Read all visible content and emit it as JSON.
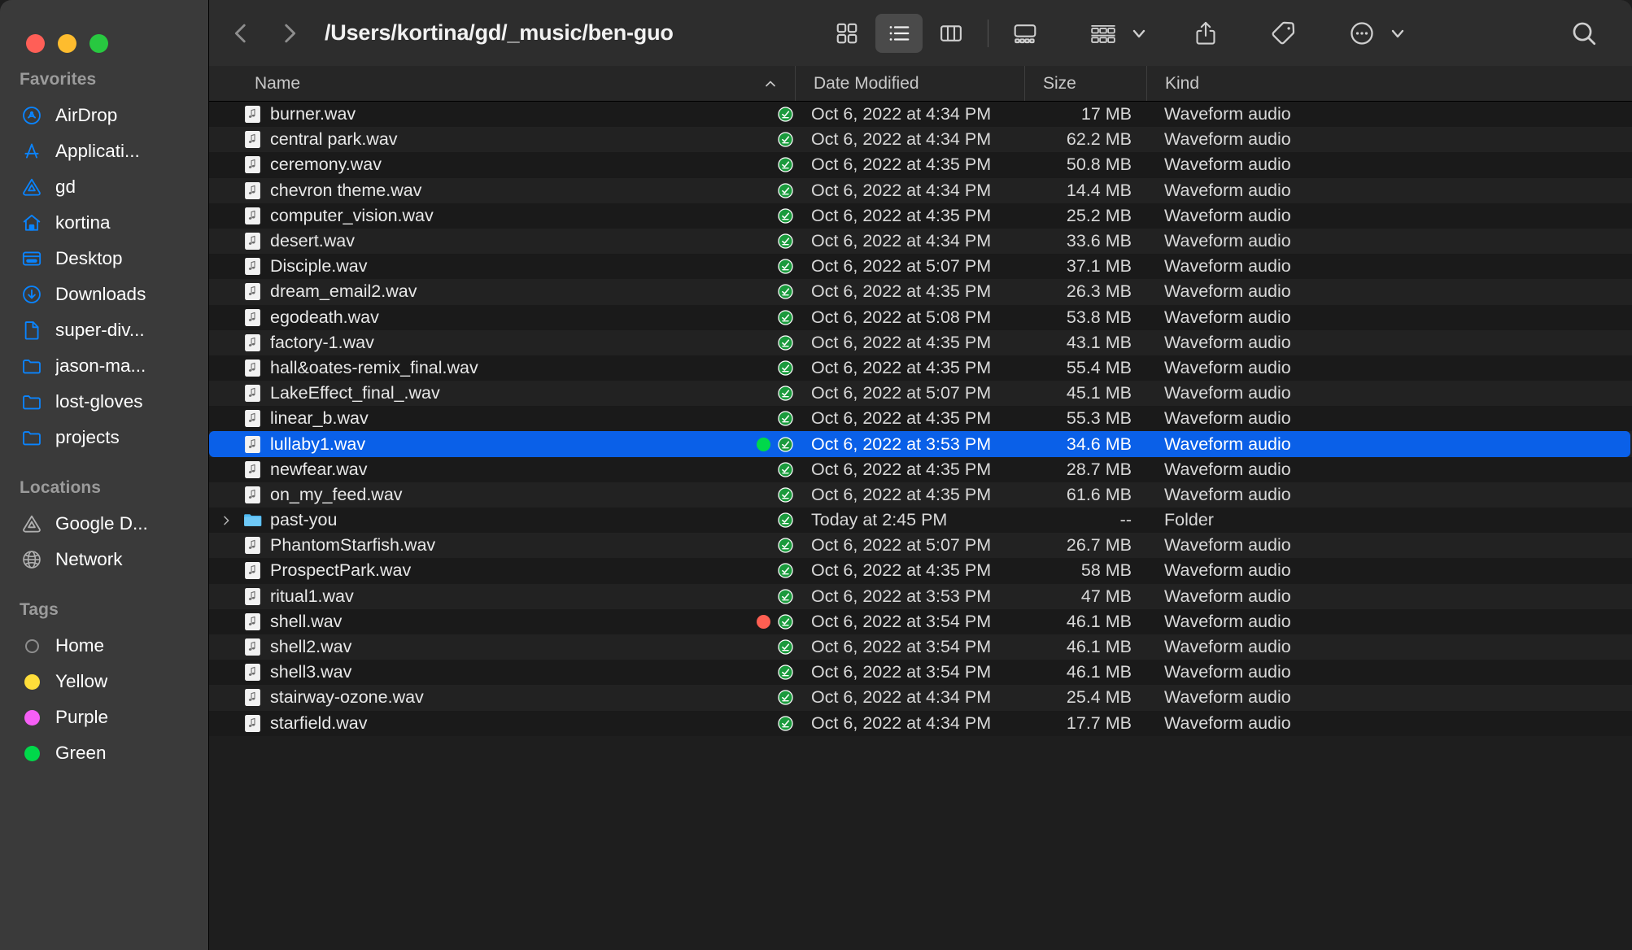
{
  "window": {
    "traffic_lights": [
      {
        "name": "close",
        "color": "#ff5f57"
      },
      {
        "name": "minimize",
        "color": "#febc2e"
      },
      {
        "name": "zoom",
        "color": "#28c840"
      }
    ]
  },
  "toolbar": {
    "back_icon": "chevron-left-icon",
    "forward_icon": "chevron-right-icon",
    "path_title": "/Users/kortina/gd/_music/ben-guo",
    "view_modes": [
      {
        "name": "icon-view",
        "icon": "grid-icon",
        "active": false
      },
      {
        "name": "list-view",
        "icon": "list-icon",
        "active": true
      },
      {
        "name": "column-view",
        "icon": "columns-icon",
        "active": false
      },
      {
        "name": "gallery-view",
        "icon": "gallery-icon",
        "active": false
      }
    ],
    "group_by_icon": "group-by-icon",
    "share_icon": "share-icon",
    "tag_icon": "tag-icon",
    "more_icon": "ellipsis-circle-icon",
    "search_icon": "search-icon"
  },
  "sidebar": {
    "sections": [
      {
        "title": "Favorites",
        "items": [
          {
            "label": "AirDrop",
            "icon": "airdrop-icon",
            "color": "#0a84ff"
          },
          {
            "label": "Applicati...",
            "icon": "applications-icon",
            "color": "#0a84ff"
          },
          {
            "label": "gd",
            "icon": "google-drive-icon",
            "color": "#0a84ff"
          },
          {
            "label": "kortina",
            "icon": "home-icon",
            "color": "#0a84ff"
          },
          {
            "label": "Desktop",
            "icon": "desktop-icon",
            "color": "#0a84ff"
          },
          {
            "label": "Downloads",
            "icon": "downloads-icon",
            "color": "#0a84ff"
          },
          {
            "label": "super-div...",
            "icon": "document-icon",
            "color": "#0a84ff"
          },
          {
            "label": "jason-ma...",
            "icon": "folder-icon",
            "color": "#0a84ff"
          },
          {
            "label": "lost-gloves",
            "icon": "folder-icon",
            "color": "#0a84ff"
          },
          {
            "label": "projects",
            "icon": "folder-icon",
            "color": "#0a84ff"
          }
        ]
      },
      {
        "title": "Locations",
        "items": [
          {
            "label": "Google D...",
            "icon": "google-drive-icon",
            "color": "#b0b0b0"
          },
          {
            "label": "Network",
            "icon": "globe-icon",
            "color": "#b0b0b0"
          }
        ]
      },
      {
        "title": "Tags",
        "items": [
          {
            "label": "Home",
            "icon": "tag-dot-icon",
            "color": "transparent"
          },
          {
            "label": "Yellow",
            "icon": "tag-dot-icon",
            "color": "#ffde3a"
          },
          {
            "label": "Purple",
            "icon": "tag-dot-icon",
            "color": "#f55ff5"
          },
          {
            "label": "Green",
            "icon": "tag-dot-icon",
            "color": "#00d84a"
          }
        ]
      }
    ]
  },
  "file_list": {
    "columns": [
      {
        "key": "name",
        "label": "Name",
        "sorted": true,
        "sort_direction": "ascending"
      },
      {
        "key": "date",
        "label": "Date Modified"
      },
      {
        "key": "size",
        "label": "Size"
      },
      {
        "key": "kind",
        "label": "Kind"
      }
    ],
    "rows": [
      {
        "name": "burner.wav",
        "date": "Oct 6, 2022 at 4:34 PM",
        "size": "17 MB",
        "kind": "Waveform audio",
        "icon": "audio-file-icon",
        "selected": false,
        "tag": null,
        "sync": true
      },
      {
        "name": "central park.wav",
        "date": "Oct 6, 2022 at 4:34 PM",
        "size": "62.2 MB",
        "kind": "Waveform audio",
        "icon": "audio-file-icon",
        "selected": false,
        "tag": null,
        "sync": true
      },
      {
        "name": "ceremony.wav",
        "date": "Oct 6, 2022 at 4:35 PM",
        "size": "50.8 MB",
        "kind": "Waveform audio",
        "icon": "audio-file-icon",
        "selected": false,
        "tag": null,
        "sync": true
      },
      {
        "name": "chevron theme.wav",
        "date": "Oct 6, 2022 at 4:34 PM",
        "size": "14.4 MB",
        "kind": "Waveform audio",
        "icon": "audio-file-icon",
        "selected": false,
        "tag": null,
        "sync": true
      },
      {
        "name": "computer_vision.wav",
        "date": "Oct 6, 2022 at 4:35 PM",
        "size": "25.2 MB",
        "kind": "Waveform audio",
        "icon": "audio-file-icon",
        "selected": false,
        "tag": null,
        "sync": true
      },
      {
        "name": "desert.wav",
        "date": "Oct 6, 2022 at 4:34 PM",
        "size": "33.6 MB",
        "kind": "Waveform audio",
        "icon": "audio-file-icon",
        "selected": false,
        "tag": null,
        "sync": true
      },
      {
        "name": "Disciple.wav",
        "date": "Oct 6, 2022 at 5:07 PM",
        "size": "37.1 MB",
        "kind": "Waveform audio",
        "icon": "audio-file-icon",
        "selected": false,
        "tag": null,
        "sync": true
      },
      {
        "name": "dream_email2.wav",
        "date": "Oct 6, 2022 at 4:35 PM",
        "size": "26.3 MB",
        "kind": "Waveform audio",
        "icon": "audio-file-icon",
        "selected": false,
        "tag": null,
        "sync": true
      },
      {
        "name": "egodeath.wav",
        "date": "Oct 6, 2022 at 5:08 PM",
        "size": "53.8 MB",
        "kind": "Waveform audio",
        "icon": "audio-file-icon",
        "selected": false,
        "tag": null,
        "sync": true
      },
      {
        "name": "factory-1.wav",
        "date": "Oct 6, 2022 at 4:35 PM",
        "size": "43.1 MB",
        "kind": "Waveform audio",
        "icon": "audio-file-icon",
        "selected": false,
        "tag": null,
        "sync": true
      },
      {
        "name": "hall&oates-remix_final.wav",
        "date": "Oct 6, 2022 at 4:35 PM",
        "size": "55.4 MB",
        "kind": "Waveform audio",
        "icon": "audio-file-icon",
        "selected": false,
        "tag": null,
        "sync": true
      },
      {
        "name": "LakeEffect_final_.wav",
        "date": "Oct 6, 2022 at 5:07 PM",
        "size": "45.1 MB",
        "kind": "Waveform audio",
        "icon": "audio-file-icon",
        "selected": false,
        "tag": null,
        "sync": true
      },
      {
        "name": "linear_b.wav",
        "date": "Oct 6, 2022 at 4:35 PM",
        "size": "55.3 MB",
        "kind": "Waveform audio",
        "icon": "audio-file-icon",
        "selected": false,
        "tag": null,
        "sync": true
      },
      {
        "name": "lullaby1.wav",
        "date": "Oct 6, 2022 at 3:53 PM",
        "size": "34.6 MB",
        "kind": "Waveform audio",
        "icon": "audio-file-icon",
        "selected": true,
        "tag": "#00d84a",
        "sync": true
      },
      {
        "name": "newfear.wav",
        "date": "Oct 6, 2022 at 4:35 PM",
        "size": "28.7 MB",
        "kind": "Waveform audio",
        "icon": "audio-file-icon",
        "selected": false,
        "tag": null,
        "sync": true
      },
      {
        "name": "on_my_feed.wav",
        "date": "Oct 6, 2022 at 4:35 PM",
        "size": "61.6 MB",
        "kind": "Waveform audio",
        "icon": "audio-file-icon",
        "selected": false,
        "tag": null,
        "sync": true
      },
      {
        "name": "past-you",
        "date": "Today at 2:45 PM",
        "size": "--",
        "kind": "Folder",
        "icon": "folder-icon",
        "selected": false,
        "tag": null,
        "sync": true,
        "expandable": true
      },
      {
        "name": "PhantomStarfish.wav",
        "date": "Oct 6, 2022 at 5:07 PM",
        "size": "26.7 MB",
        "kind": "Waveform audio",
        "icon": "audio-file-icon",
        "selected": false,
        "tag": null,
        "sync": true
      },
      {
        "name": "ProspectPark.wav",
        "date": "Oct 6, 2022 at 4:35 PM",
        "size": "58 MB",
        "kind": "Waveform audio",
        "icon": "audio-file-icon",
        "selected": false,
        "tag": null,
        "sync": true
      },
      {
        "name": "ritual1.wav",
        "date": "Oct 6, 2022 at 3:53 PM",
        "size": "47 MB",
        "kind": "Waveform audio",
        "icon": "audio-file-icon",
        "selected": false,
        "tag": null,
        "sync": true
      },
      {
        "name": "shell.wav",
        "date": "Oct 6, 2022 at 3:54 PM",
        "size": "46.1 MB",
        "kind": "Waveform audio",
        "icon": "audio-file-icon",
        "selected": false,
        "tag": "#ff5f52",
        "sync": true
      },
      {
        "name": "shell2.wav",
        "date": "Oct 6, 2022 at 3:54 PM",
        "size": "46.1 MB",
        "kind": "Waveform audio",
        "icon": "audio-file-icon",
        "selected": false,
        "tag": null,
        "sync": true
      },
      {
        "name": "shell3.wav",
        "date": "Oct 6, 2022 at 3:54 PM",
        "size": "46.1 MB",
        "kind": "Waveform audio",
        "icon": "audio-file-icon",
        "selected": false,
        "tag": null,
        "sync": true
      },
      {
        "name": "stairway-ozone.wav",
        "date": "Oct 6, 2022 at 4:34 PM",
        "size": "25.4 MB",
        "kind": "Waveform audio",
        "icon": "audio-file-icon",
        "selected": false,
        "tag": null,
        "sync": true
      },
      {
        "name": "starfield.wav",
        "date": "Oct 6, 2022 at 4:34 PM",
        "size": "17.7 MB",
        "kind": "Waveform audio",
        "icon": "audio-file-icon",
        "selected": false,
        "tag": null,
        "sync": true
      }
    ]
  }
}
